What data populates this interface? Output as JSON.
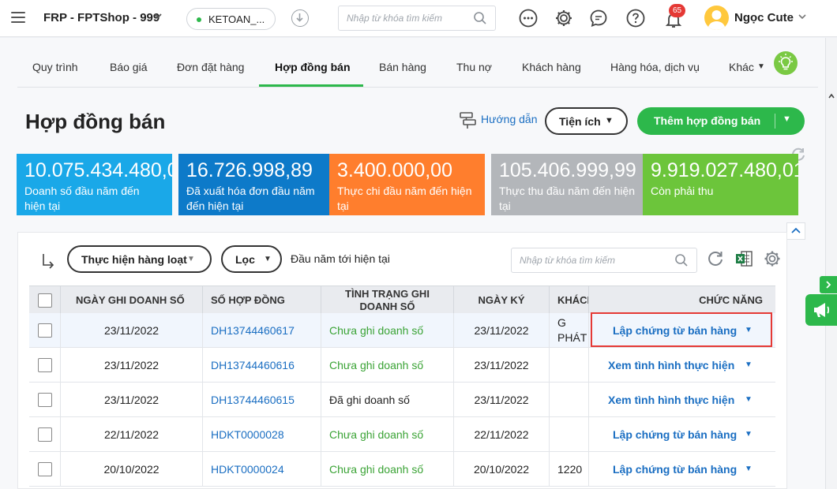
{
  "topbar": {
    "app_name": "FRP - FPTShop - 999",
    "database": "KETOAN_...",
    "search_placeholder": "Nhập từ khóa tìm kiếm",
    "notification_count": "65",
    "user_name": "Ngọc Cute"
  },
  "tabs": [
    "Quy trình",
    "Báo giá",
    "Đơn đặt hàng",
    "Hợp đồng bán",
    "Bán hàng",
    "Thu nợ",
    "Khách hàng",
    "Hàng hóa, dịch vụ",
    "Khác"
  ],
  "page": {
    "title": "Hợp đồng bán",
    "guide": "Hướng dẫn",
    "utilities": "Tiện ích",
    "add_button": "Thêm hợp đồng bán"
  },
  "kpis": [
    {
      "value": "10.075.434.480,0",
      "label": "Doanh số đầu năm đến hiện tại",
      "color": "#1aa8e8"
    },
    {
      "value": "16.726.998,89",
      "label": "Đã xuất hóa đơn đầu năm đến hiện tại",
      "color": "#0d7ac9"
    },
    {
      "value": "3.400.000,00",
      "label": "Thực chi đầu năm đến hiện tại",
      "color": "#ff7e2d"
    },
    {
      "value": "105.406.999,99",
      "label": "Thực thu đầu năm đến hiện tại",
      "color": "#b3b6ba"
    },
    {
      "value": "9.919.027.480,01",
      "label": "Còn phải thu",
      "color": "#6cc53b"
    }
  ],
  "toolbar": {
    "batch": "Thực hiện hàng loạt",
    "filter": "Lọc",
    "period": "Đầu năm tới hiện tại",
    "search_placeholder": "Nhập từ khóa tìm kiếm"
  },
  "table": {
    "headers": [
      "NGÀY GHI DOANH SỐ",
      "SỐ HỢP ĐỒNG",
      "TÌNH TRẠNG GHI DOANH SỐ",
      "NGÀY KÝ",
      "KHÁCH",
      "CHỨC NĂNG"
    ],
    "rows": [
      {
        "date": "23/11/2022",
        "contract": "DH13744460617",
        "status": "Chưa ghi doanh số",
        "signed": "23/11/2022",
        "customer": "CÔNG PHÁT -",
        "action": "Lập chứng từ bán hàng"
      },
      {
        "date": "23/11/2022",
        "contract": "DH13744460616",
        "status": "Chưa ghi doanh số",
        "signed": "23/11/2022",
        "customer": "",
        "action": "Xem tình hình thực hiện"
      },
      {
        "date": "23/11/2022",
        "contract": "DH13744460615",
        "status": "Đã ghi doanh số",
        "signed": "23/11/2022",
        "customer": "",
        "action": "Xem tình hình thực hiện"
      },
      {
        "date": "22/11/2022",
        "contract": "HDKT0000028",
        "status": "Chưa ghi doanh số",
        "signed": "22/11/2022",
        "customer": "",
        "action": "Lập chứng từ bán hàng"
      },
      {
        "date": "20/10/2022",
        "contract": "HDKT0000024",
        "status": "Chưa ghi doanh số",
        "signed": "20/10/2022",
        "customer": "1220",
        "action": "Lập chứng từ bán hàng"
      }
    ]
  }
}
